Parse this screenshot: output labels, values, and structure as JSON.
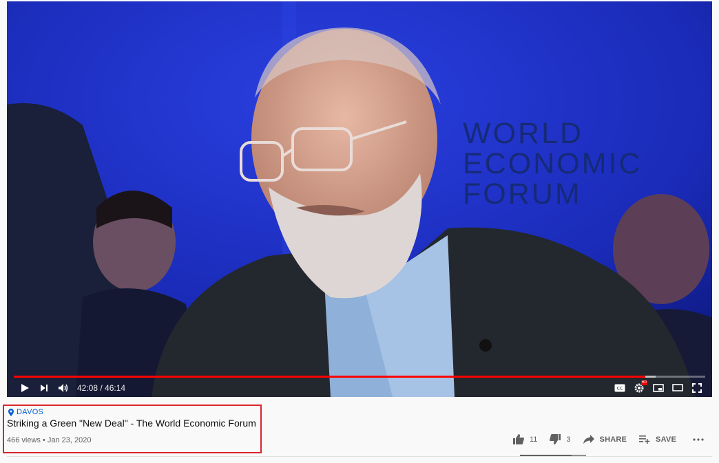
{
  "player": {
    "background_text": [
      "WORLD",
      "ECONOMIC",
      "FORUM"
    ],
    "progress": 0.913,
    "time_current": "42:08",
    "time_separator": " / ",
    "time_total": "46:14",
    "progress_color": "#ff0000",
    "icons": {
      "play": "play-icon",
      "next": "next-icon",
      "volume": "volume-icon",
      "captions": "captions-icon",
      "settings": "settings-gear-icon",
      "settings_badge": "HD",
      "miniplayer": "miniplayer-icon",
      "theater": "theater-mode-icon",
      "fullscreen": "fullscreen-icon"
    }
  },
  "video_info": {
    "location": "DAVOS",
    "title": "Striking a Green \"New Deal\" - The World Economic Forum",
    "views": "466 views",
    "bullet": " • ",
    "date": "Jan 23, 2020",
    "likes": "11",
    "dislikes": "3",
    "like_ratio": 0.786,
    "share_label": "SHARE",
    "save_label": "SAVE",
    "highlight_color": "#d9252c",
    "link_color": "#065fd4"
  }
}
